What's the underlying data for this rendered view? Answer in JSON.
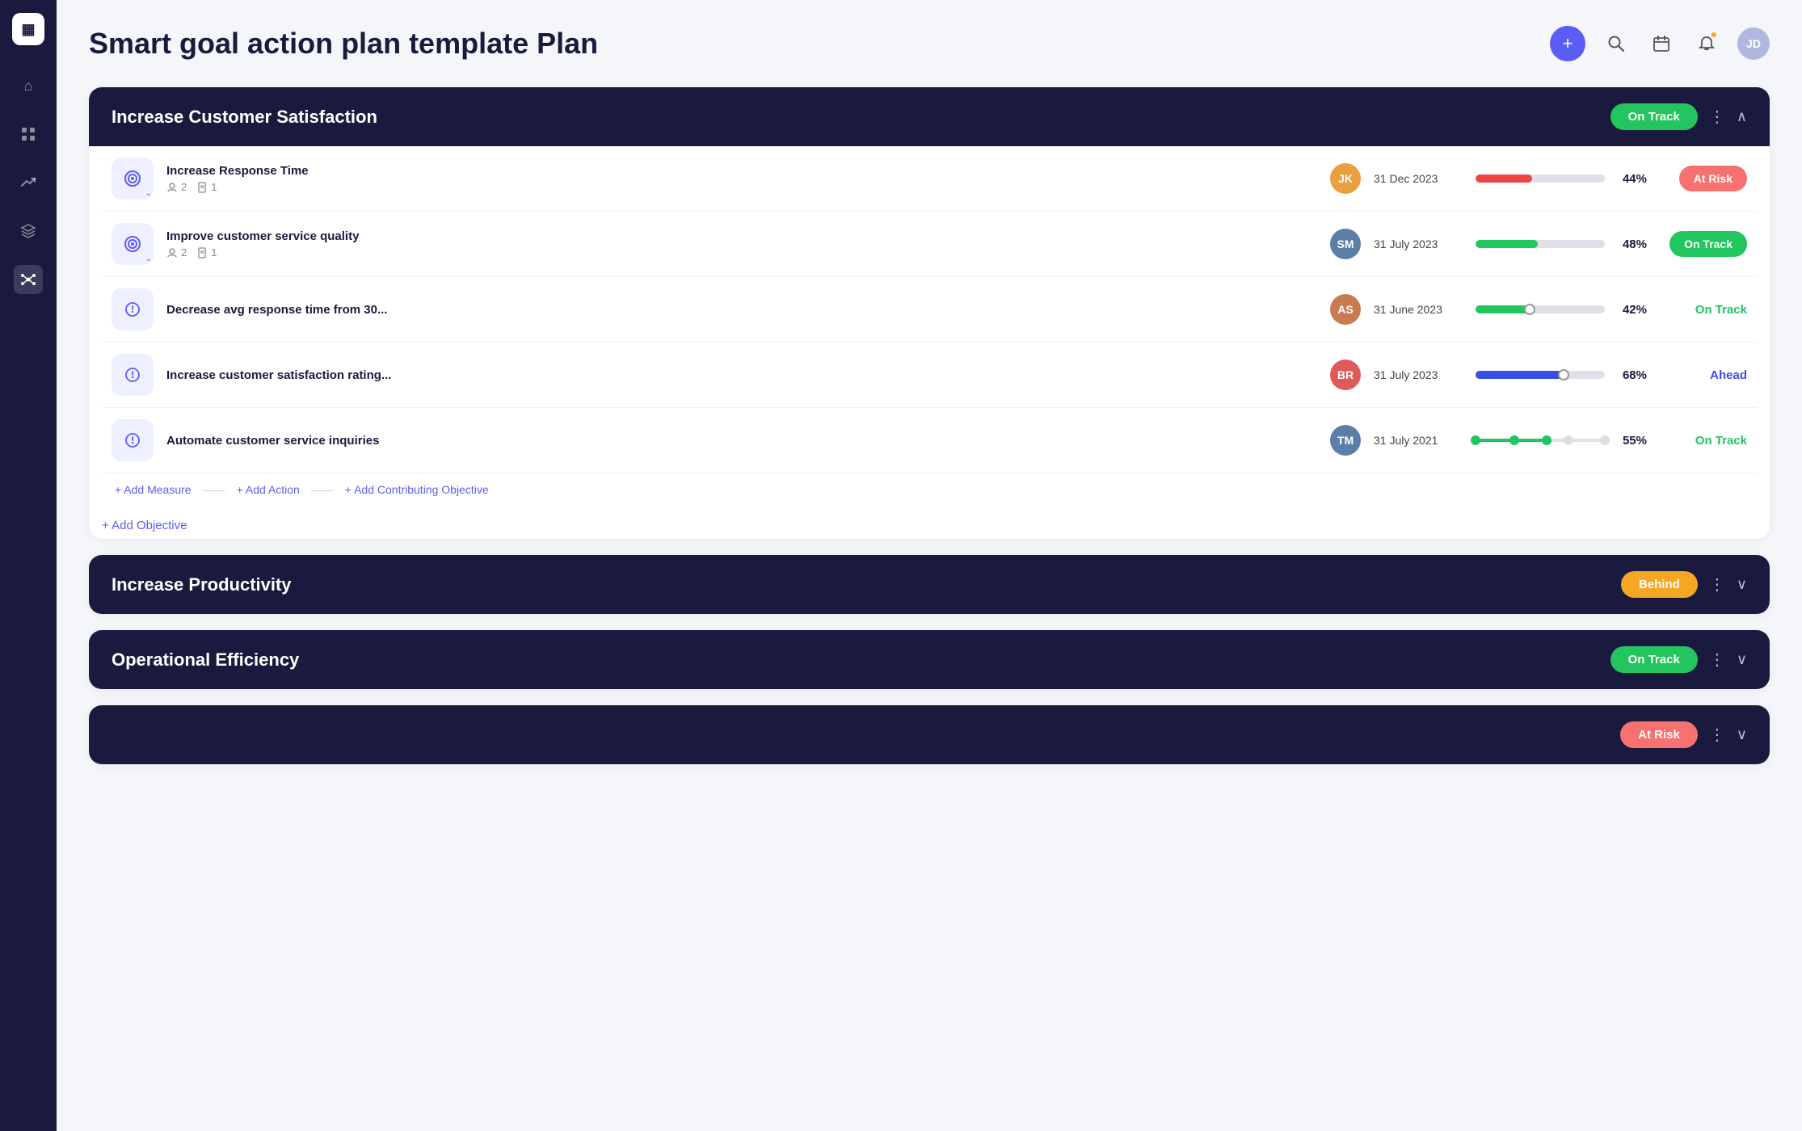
{
  "app": {
    "logo": "▦",
    "title": "Smart goal action plan template Plan",
    "user_initials": "JD"
  },
  "sidebar": {
    "items": [
      {
        "id": "home",
        "icon": "⌂",
        "active": false
      },
      {
        "id": "chart",
        "icon": "▤",
        "active": false
      },
      {
        "id": "trending",
        "icon": "↗",
        "active": false
      },
      {
        "id": "layers",
        "icon": "◫",
        "active": false
      },
      {
        "id": "network",
        "icon": "⬡",
        "active": true
      }
    ]
  },
  "sections": [
    {
      "id": "customer-satisfaction",
      "title": "Increase Customer Satisfaction",
      "status": "On Track",
      "status_class": "badge-on-track",
      "expanded": true,
      "objectives": [
        {
          "id": "obj-1",
          "name": "Increase Response Time",
          "count_people": 2,
          "count_docs": 1,
          "date": "31 Dec 2023",
          "progress": 44,
          "progress_color": "#ef4444",
          "status": "At Risk",
          "status_type": "badge",
          "status_badge_class": "badge-at-risk",
          "avatar_color": "#e8a040",
          "avatar_initials": "JK",
          "type": "objective"
        },
        {
          "id": "obj-2",
          "name": "Improve customer service quality",
          "count_people": 2,
          "count_docs": 1,
          "date": "31 July 2023",
          "progress": 48,
          "progress_color": "#22c55e",
          "status": "On Track",
          "status_type": "badge",
          "status_badge_class": "badge-on-track",
          "avatar_color": "#5b7fa6",
          "avatar_initials": "SM",
          "type": "objective"
        },
        {
          "id": "obj-3",
          "name": "Decrease avg response time from 30...",
          "date": "31 June 2023",
          "progress": 42,
          "progress_color": "#22c55e",
          "show_thumb": true,
          "status": "On Track",
          "status_type": "text",
          "status_color": "#22c55e",
          "avatar_color": "#c97a50",
          "avatar_initials": "AS",
          "type": "measure"
        },
        {
          "id": "obj-4",
          "name": "Increase customer satisfaction rating...",
          "date": "31 July 2023",
          "progress": 68,
          "progress_color": "#3b4de8",
          "show_thumb": true,
          "status": "Ahead",
          "status_type": "text",
          "status_color": "#3b4de8",
          "avatar_color": "#e05a5a",
          "avatar_initials": "BR",
          "type": "measure"
        },
        {
          "id": "obj-5",
          "name": "Automate customer service inquiries",
          "date": "31 July 2021",
          "progress": 55,
          "progress_color": "#22c55e",
          "show_slider_dots": true,
          "status": "On Track",
          "status_type": "text",
          "status_color": "#22c55e",
          "avatar_color": "#5b7fa6",
          "avatar_initials": "TM",
          "type": "measure"
        }
      ],
      "add_links": [
        {
          "label": "+ Add Measure"
        },
        {
          "label": "+ Add Action"
        },
        {
          "label": "+ Add Contributing Objective"
        }
      ],
      "add_objective_label": "+ Add Objective"
    },
    {
      "id": "productivity",
      "title": "Increase Productivity",
      "status": "Behind",
      "status_class": "badge-behind",
      "expanded": false,
      "objectives": []
    },
    {
      "id": "operational",
      "title": "Operational Efficiency",
      "status": "On Track",
      "status_class": "badge-on-track",
      "expanded": false,
      "objectives": []
    },
    {
      "id": "fourth-section",
      "title": "",
      "status": "At Risk",
      "status_class": "badge-at-risk",
      "expanded": false,
      "objectives": [],
      "partial": true
    }
  ],
  "icons": {
    "plus": "+",
    "search": "🔍",
    "calendar": "📅",
    "bell": "🔔",
    "more": "⋮",
    "chevron_up": "∧",
    "chevron_down": "∨",
    "people": "👤",
    "doc": "📄",
    "target": "◎",
    "measure": "⏱"
  }
}
